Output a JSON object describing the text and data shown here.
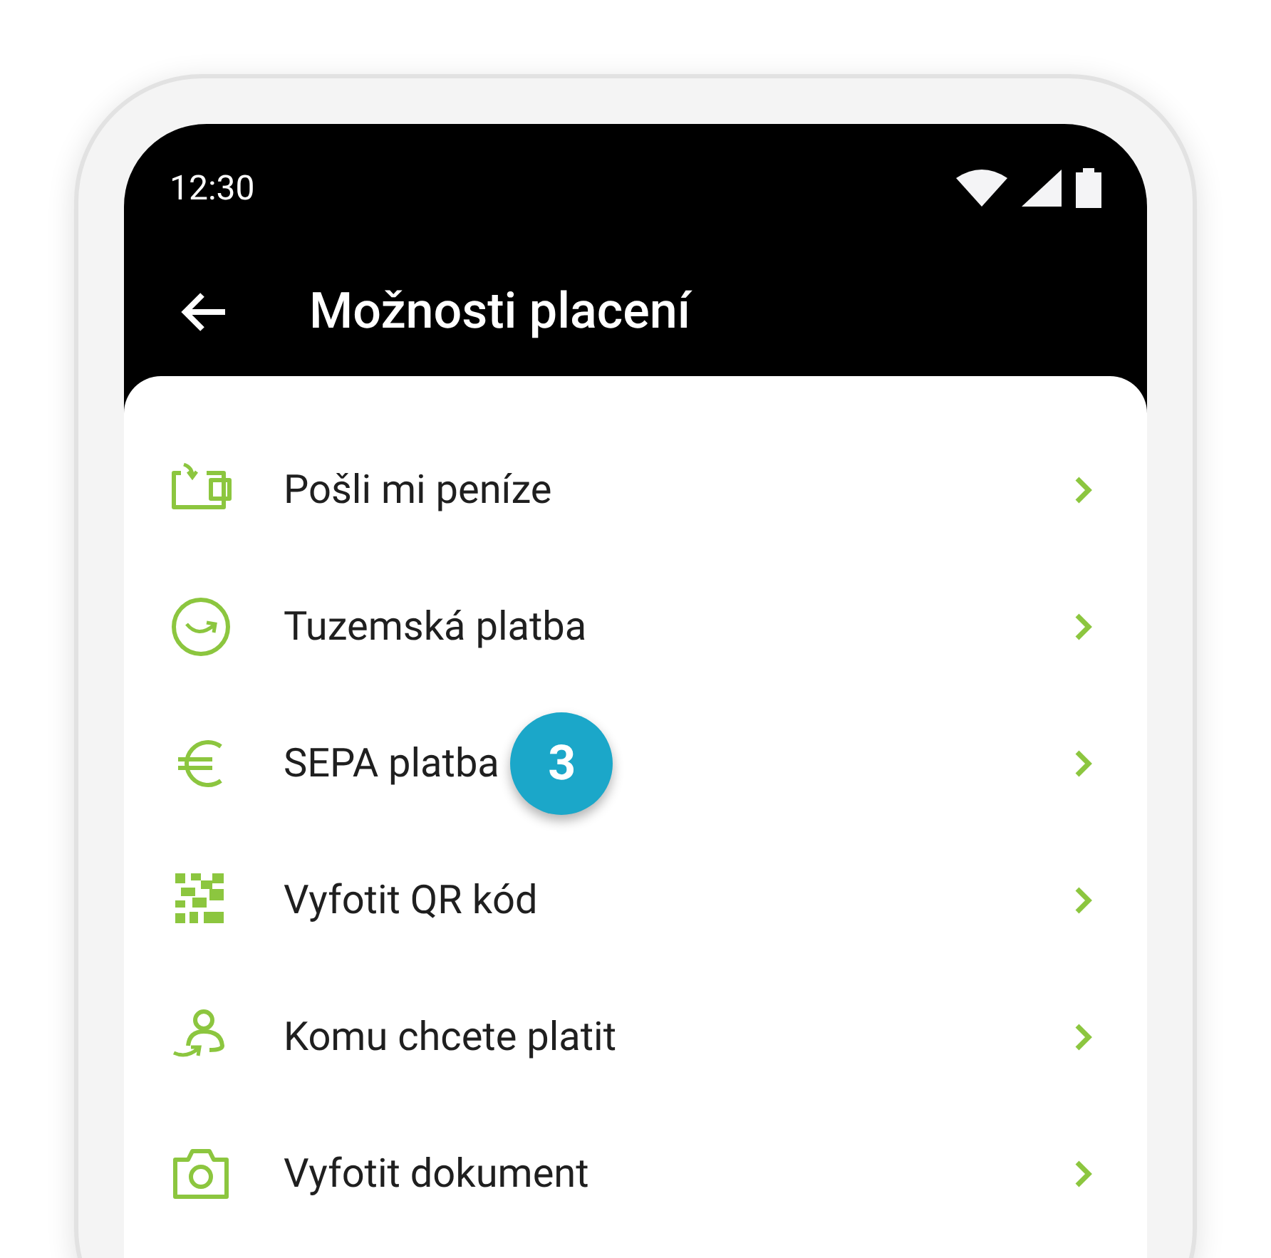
{
  "status_bar": {
    "time": "12:30"
  },
  "app_bar": {
    "title": "Možnosti placení"
  },
  "items": [
    {
      "kind": "wallet",
      "label": "Pošli mi peníze"
    },
    {
      "kind": "domestic",
      "label": "Tuzemská platba"
    },
    {
      "kind": "euro",
      "label": "SEPA platba",
      "badge": "3"
    },
    {
      "kind": "qr",
      "label": "Vyfotit QR kód"
    },
    {
      "kind": "person",
      "label": "Komu chcete platit"
    },
    {
      "kind": "camera",
      "label": "Vyfotit dokument"
    }
  ]
}
